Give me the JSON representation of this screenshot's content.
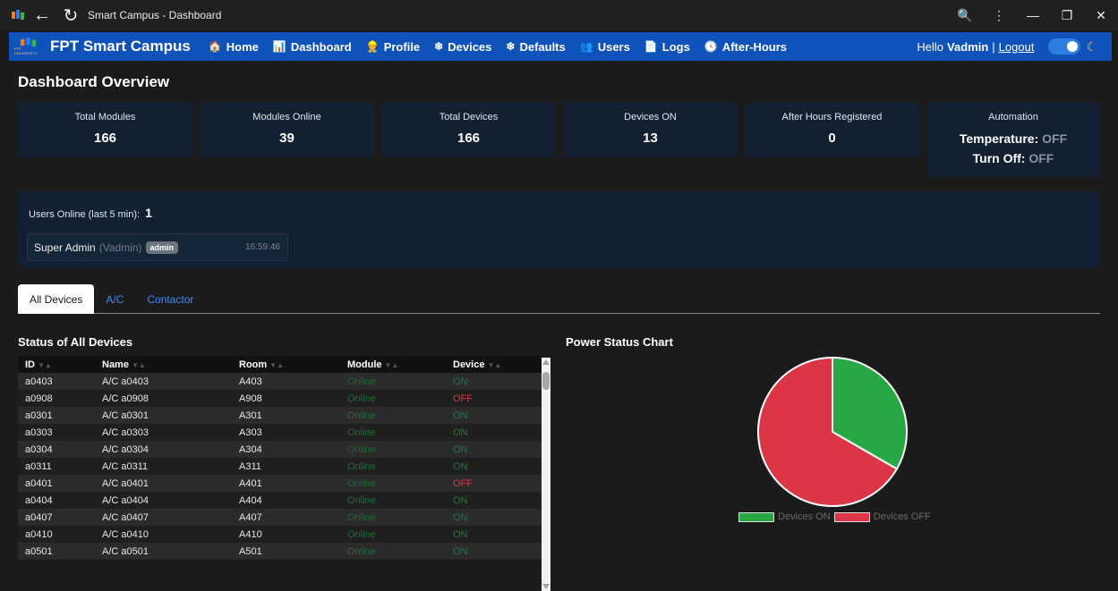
{
  "window": {
    "title": "Smart Campus - Dashboard"
  },
  "navbar": {
    "brand": "FPT Smart Campus",
    "logo_sub": "FPT UNIVERSITY",
    "items": [
      {
        "icon": "home-icon",
        "glyph": "🏠",
        "label": "Home"
      },
      {
        "icon": "dashboard-icon",
        "glyph": "📊",
        "label": "Dashboard"
      },
      {
        "icon": "profile-icon",
        "glyph": "👷",
        "label": "Profile"
      },
      {
        "icon": "snowflake-icon",
        "glyph": "❄",
        "label": "Devices"
      },
      {
        "icon": "defaults-icon",
        "glyph": "❄",
        "label": "Defaults"
      },
      {
        "icon": "users-icon",
        "glyph": "👥",
        "label": "Users"
      },
      {
        "icon": "logs-icon",
        "glyph": "📄",
        "label": "Logs"
      },
      {
        "icon": "clock-icon",
        "glyph": "🕓",
        "label": "After-Hours"
      }
    ],
    "greeting": "Hello",
    "username": "Vadmin",
    "separator": "|",
    "logout": "Logout"
  },
  "page": {
    "title": "Dashboard Overview"
  },
  "stats": [
    {
      "label": "Total Modules",
      "value": "166"
    },
    {
      "label": "Modules Online",
      "value": "39"
    },
    {
      "label": "Total Devices",
      "value": "166"
    },
    {
      "label": "Devices ON",
      "value": "13"
    },
    {
      "label": "After Hours Registered",
      "value": "0"
    }
  ],
  "automation": {
    "label": "Automation",
    "temp_label": "Temperature:",
    "temp_value": "OFF",
    "turnoff_label": "Turn Off:",
    "turnoff_value": "OFF"
  },
  "users_online": {
    "label": "Users Online (last 5 min):",
    "count": "1",
    "users": [
      {
        "name": "Super Admin",
        "handle": "(Vadmin)",
        "badge": "admin",
        "time": "16:59:46"
      }
    ]
  },
  "tabs": [
    {
      "label": "All Devices",
      "active": true
    },
    {
      "label": "A/C",
      "active": false
    },
    {
      "label": "Contactor",
      "active": false
    }
  ],
  "table": {
    "title": "Status of All Devices",
    "columns": [
      "ID",
      "Name",
      "Room",
      "Module",
      "Device"
    ],
    "rows": [
      [
        "a0403",
        "A/C a0403",
        "A403",
        "Online",
        "ON"
      ],
      [
        "a0908",
        "A/C a0908",
        "A908",
        "Online",
        "OFF"
      ],
      [
        "a0301",
        "A/C a0301",
        "A301",
        "Online",
        "ON"
      ],
      [
        "a0303",
        "A/C a0303",
        "A303",
        "Online",
        "ON"
      ],
      [
        "a0304",
        "A/C a0304",
        "A304",
        "Online",
        "ON"
      ],
      [
        "a0311",
        "A/C a0311",
        "A311",
        "Online",
        "ON"
      ],
      [
        "a0401",
        "A/C a0401",
        "A401",
        "Online",
        "OFF"
      ],
      [
        "a0404",
        "A/C a0404",
        "A404",
        "Online",
        "ON"
      ],
      [
        "a0407",
        "A/C a0407",
        "A407",
        "Online",
        "ON"
      ],
      [
        "a0410",
        "A/C a0410",
        "A410",
        "Online",
        "ON"
      ],
      [
        "a0501",
        "A/C a0501",
        "A501",
        "Online",
        "ON"
      ]
    ]
  },
  "chart_data": {
    "type": "pie",
    "title": "Power Status Chart",
    "categories": [
      "Devices ON",
      "Devices OFF"
    ],
    "values": [
      13,
      26
    ],
    "colors": [
      "#28a745",
      "#dc3545"
    ],
    "legend": "bottom"
  }
}
